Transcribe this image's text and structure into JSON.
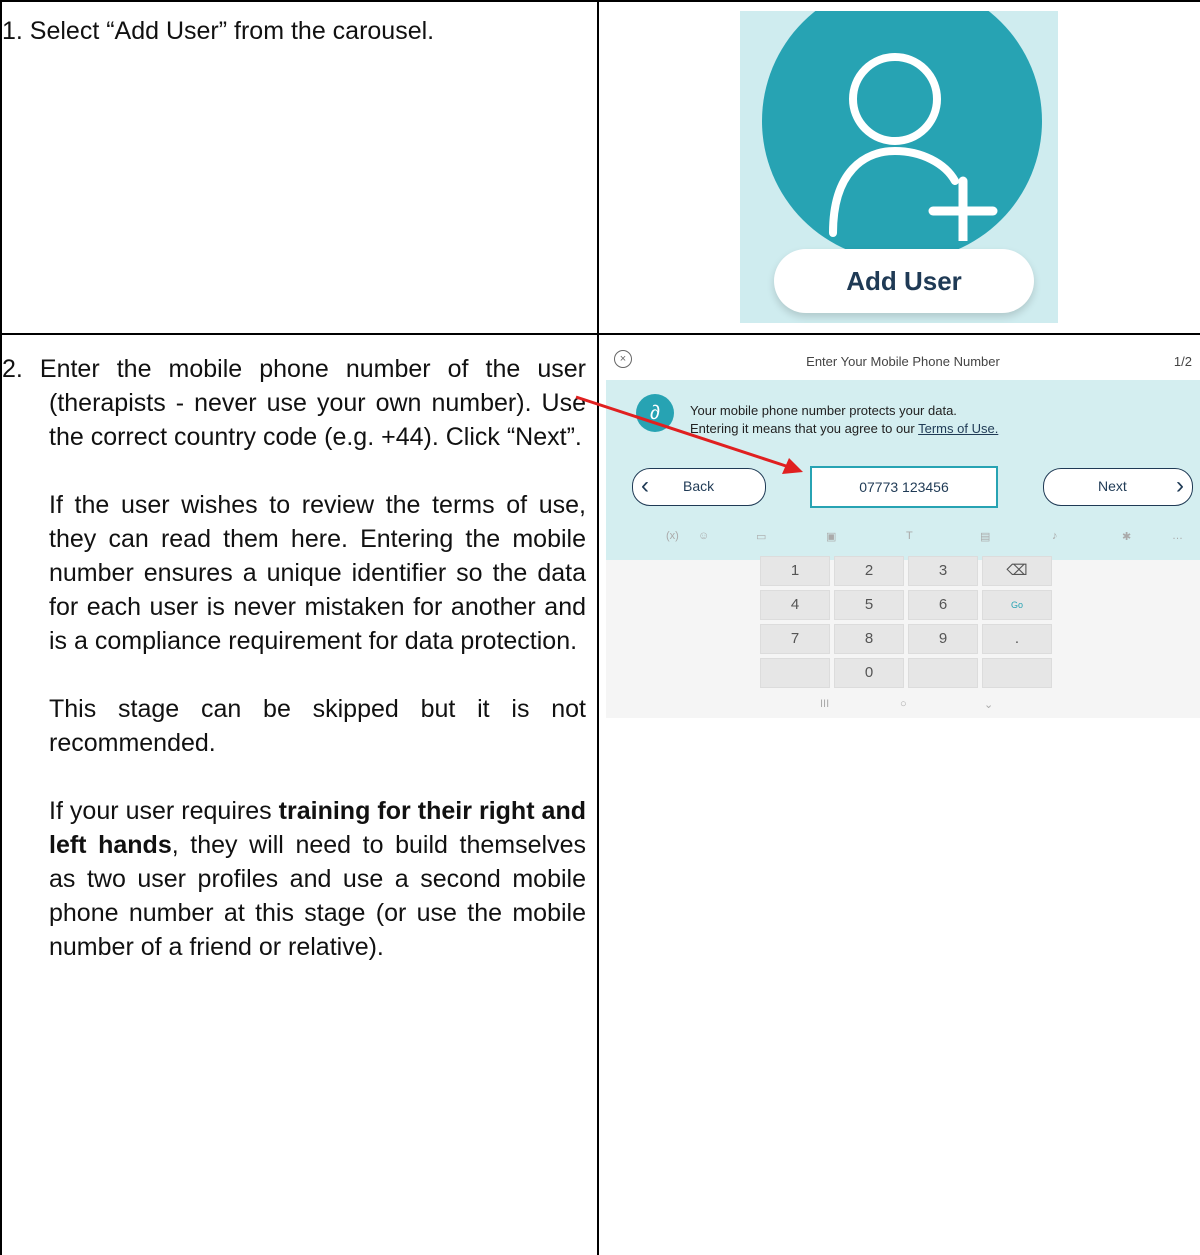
{
  "step1": {
    "text": "1. Select “Add User” from the carousel."
  },
  "add_user_graphic": {
    "button_label": "Add User",
    "icon": "add-user-icon",
    "colors": {
      "circle": "#27a3b3",
      "background": "#cfecef"
    }
  },
  "step2": {
    "p1": "2. Enter the mobile phone number of the user (therapists - never use your own number). Use the correct country code (e.g. +44). Click “Next”.",
    "p2": "If the user wishes to review the terms of use, they can read them here. Entering the mobile number ensures a unique identifier so the data for each user is never mistaken for another and is a compliance requirement for data protection.",
    "p3": "This stage can be skipped but it is not recommended.",
    "p4_pre": "If your user requires ",
    "p4_bold": "training for their right and left hands",
    "p4_post": ", they will need to build themselves as two user profiles and use a second mobile phone number at this stage (or use the mobile number of a friend or relative)."
  },
  "phone_screen": {
    "title": "Enter Your Mobile Phone Number",
    "page": "1/2",
    "info_line1": "Your mobile phone number protects your data.",
    "info_line2_pre": "Entering it means that you agree to our ",
    "info_link": "Terms of Use.",
    "back_label": "Back",
    "next_label": "Next",
    "phone_value": "07773 123456",
    "keys": [
      "1",
      "2",
      "3",
      "⌫",
      "4",
      "5",
      "6",
      "Go",
      "7",
      "8",
      "9",
      ".",
      "",
      "0",
      "",
      ""
    ],
    "arrow_color": "#e02020"
  }
}
